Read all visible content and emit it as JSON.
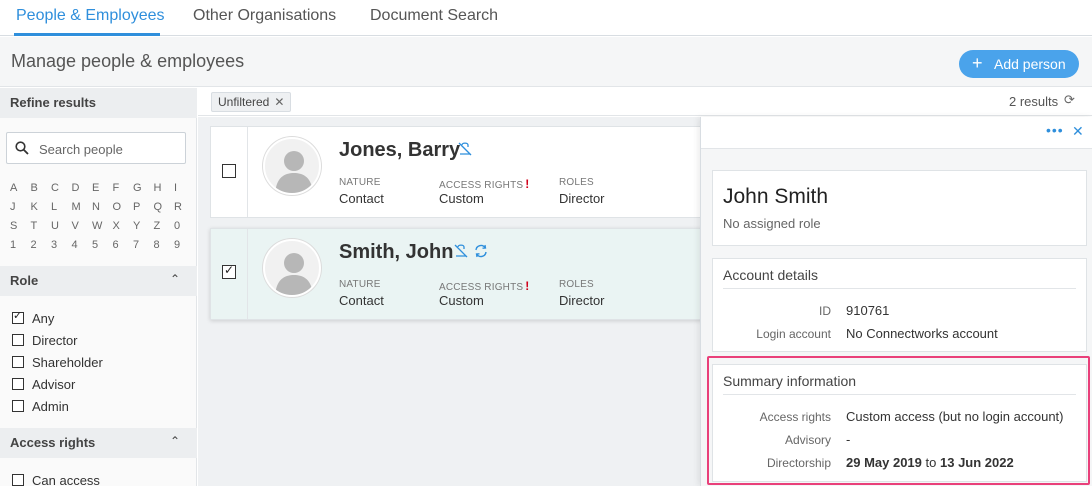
{
  "nav": {
    "tabs": [
      {
        "label": "People & Employees",
        "active": true
      },
      {
        "label": "Other Organisations",
        "active": false
      },
      {
        "label": "Document Search",
        "active": false
      }
    ]
  },
  "header": {
    "title": "Manage people & employees",
    "add_button": "Add person"
  },
  "sidebar": {
    "refine_title": "Refine results",
    "search_placeholder": "Search people",
    "letters": [
      "A",
      "B",
      "C",
      "D",
      "E",
      "F",
      "G",
      "H",
      "I",
      "J",
      "K",
      "L",
      "M",
      "N",
      "O",
      "P",
      "Q",
      "R",
      "S",
      "T",
      "U",
      "V",
      "W",
      "X",
      "Y",
      "Z",
      "0",
      "1",
      "2",
      "3",
      "4",
      "5",
      "6",
      "7",
      "8",
      "9"
    ],
    "role_section": {
      "title": "Role",
      "options": [
        {
          "label": "Any",
          "checked": true
        },
        {
          "label": "Director",
          "checked": false
        },
        {
          "label": "Shareholder",
          "checked": false
        },
        {
          "label": "Advisor",
          "checked": false
        },
        {
          "label": "Admin",
          "checked": false
        }
      ]
    },
    "access_section": {
      "title": "Access rights",
      "options": [
        {
          "label": "Can access",
          "checked": false
        }
      ]
    }
  },
  "filterbar": {
    "chip": "Unfiltered",
    "results": "2 results"
  },
  "columns": {
    "nature": "NATURE",
    "access": "ACCESS RIGHTS",
    "roles": "ROLES"
  },
  "people": [
    {
      "name": "Jones, Barry",
      "nature": "Contact",
      "access": "Custom",
      "roles": "Director",
      "selected": false
    },
    {
      "name": "Smith, John",
      "nature": "Contact",
      "access": "Custom",
      "roles": "Director",
      "selected": true
    }
  ],
  "detail": {
    "name": "John Smith",
    "subtitle": "No assigned role",
    "account": {
      "title": "Account details",
      "id_label": "ID",
      "id_value": "910761",
      "login_label": "Login account",
      "login_value": "No Connectworks account"
    },
    "summary": {
      "title": "Summary information",
      "access_label": "Access rights",
      "access_value": "Custom access (but no login account)",
      "advisory_label": "Advisory",
      "advisory_value": "-",
      "directorship_label": "Directorship",
      "directorship_from": "29 May 2019",
      "directorship_to_word": "to",
      "directorship_to": "13 Jun 2022"
    }
  },
  "colors": {
    "accent": "#2f8fdc",
    "button": "#4aa3eb",
    "highlight": "#e9407a",
    "warning": "#d0021b"
  }
}
